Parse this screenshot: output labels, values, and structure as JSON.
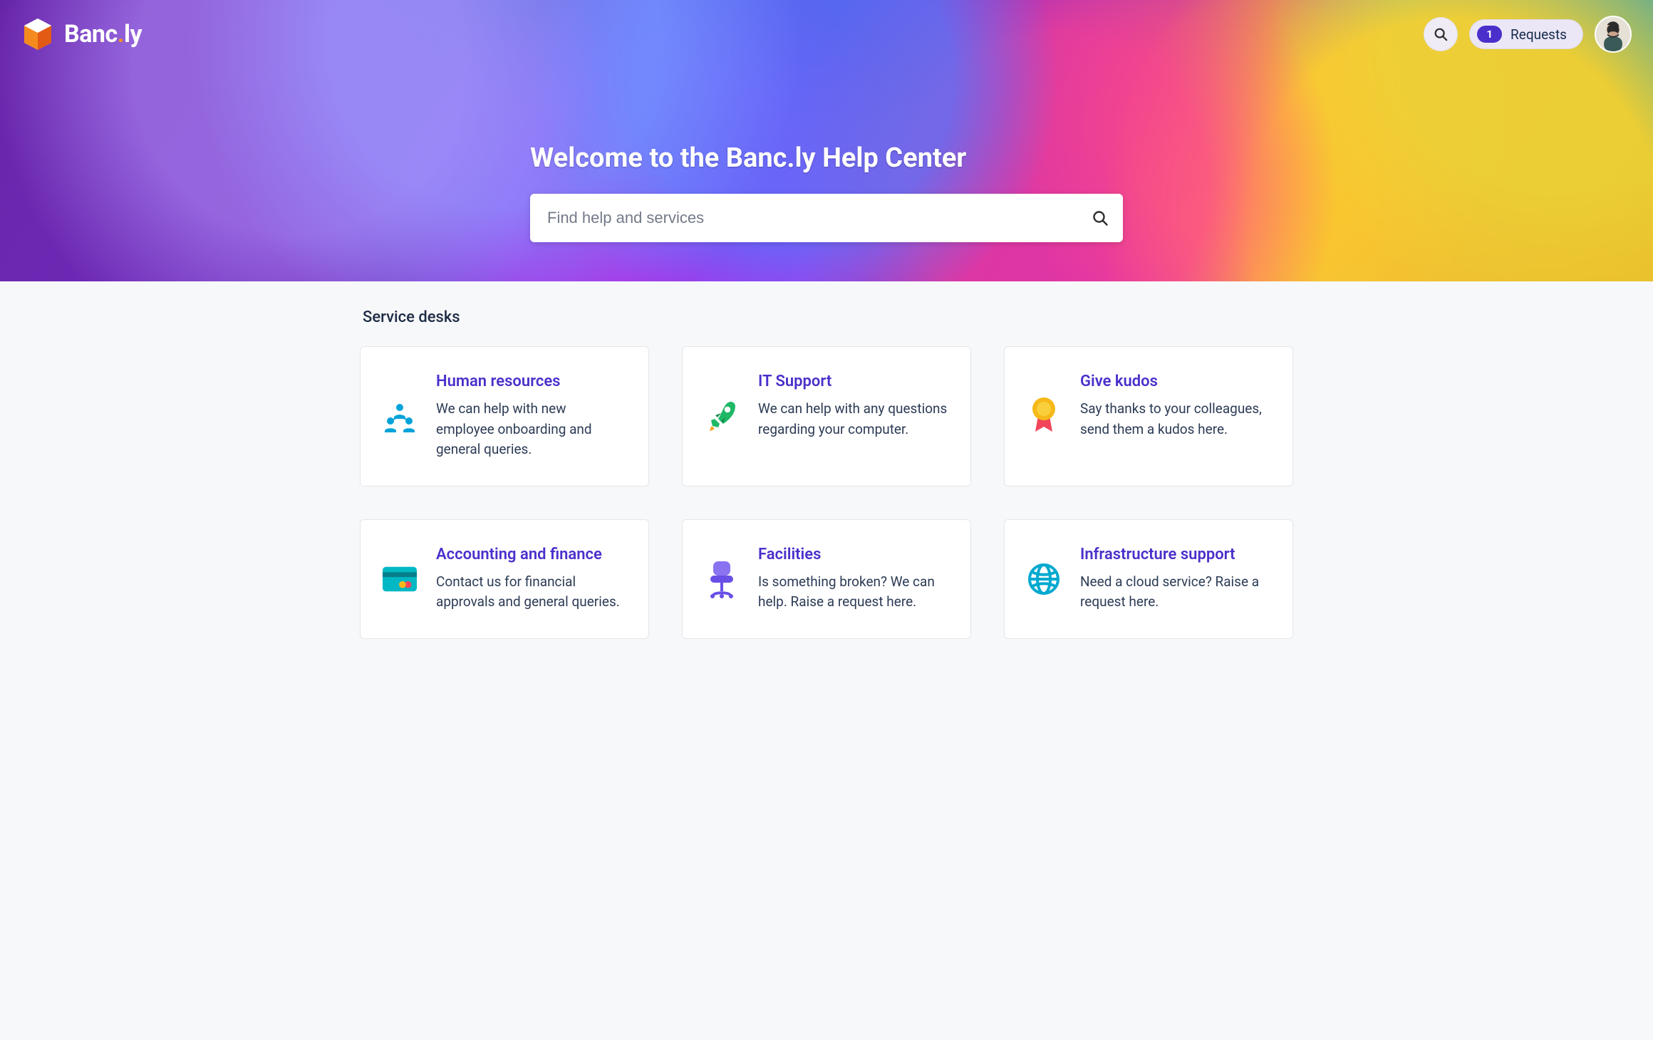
{
  "brand": {
    "name": "Banc",
    "suffix": "ly"
  },
  "header": {
    "requests_count": "1",
    "requests_label": "Requests"
  },
  "hero": {
    "title": "Welcome to the Banc.ly Help Center",
    "search_placeholder": "Find help and services"
  },
  "section_title": "Service desks",
  "desks": [
    {
      "title": "Human resources",
      "desc": "We can help with new employee onboarding and general queries."
    },
    {
      "title": "IT Support",
      "desc": "We can help with any questions regarding your computer."
    },
    {
      "title": "Give kudos",
      "desc": "Say thanks to your colleagues, send them a kudos here."
    },
    {
      "title": "Accounting and finance",
      "desc": "Contact us for financial approvals and general queries."
    },
    {
      "title": "Facilities",
      "desc": "Is something broken? We can help. Raise a request here."
    },
    {
      "title": "Infrastructure support",
      "desc": "Need a cloud service? Raise a request here."
    }
  ],
  "colors": {
    "accent": "#4b2fcb"
  }
}
